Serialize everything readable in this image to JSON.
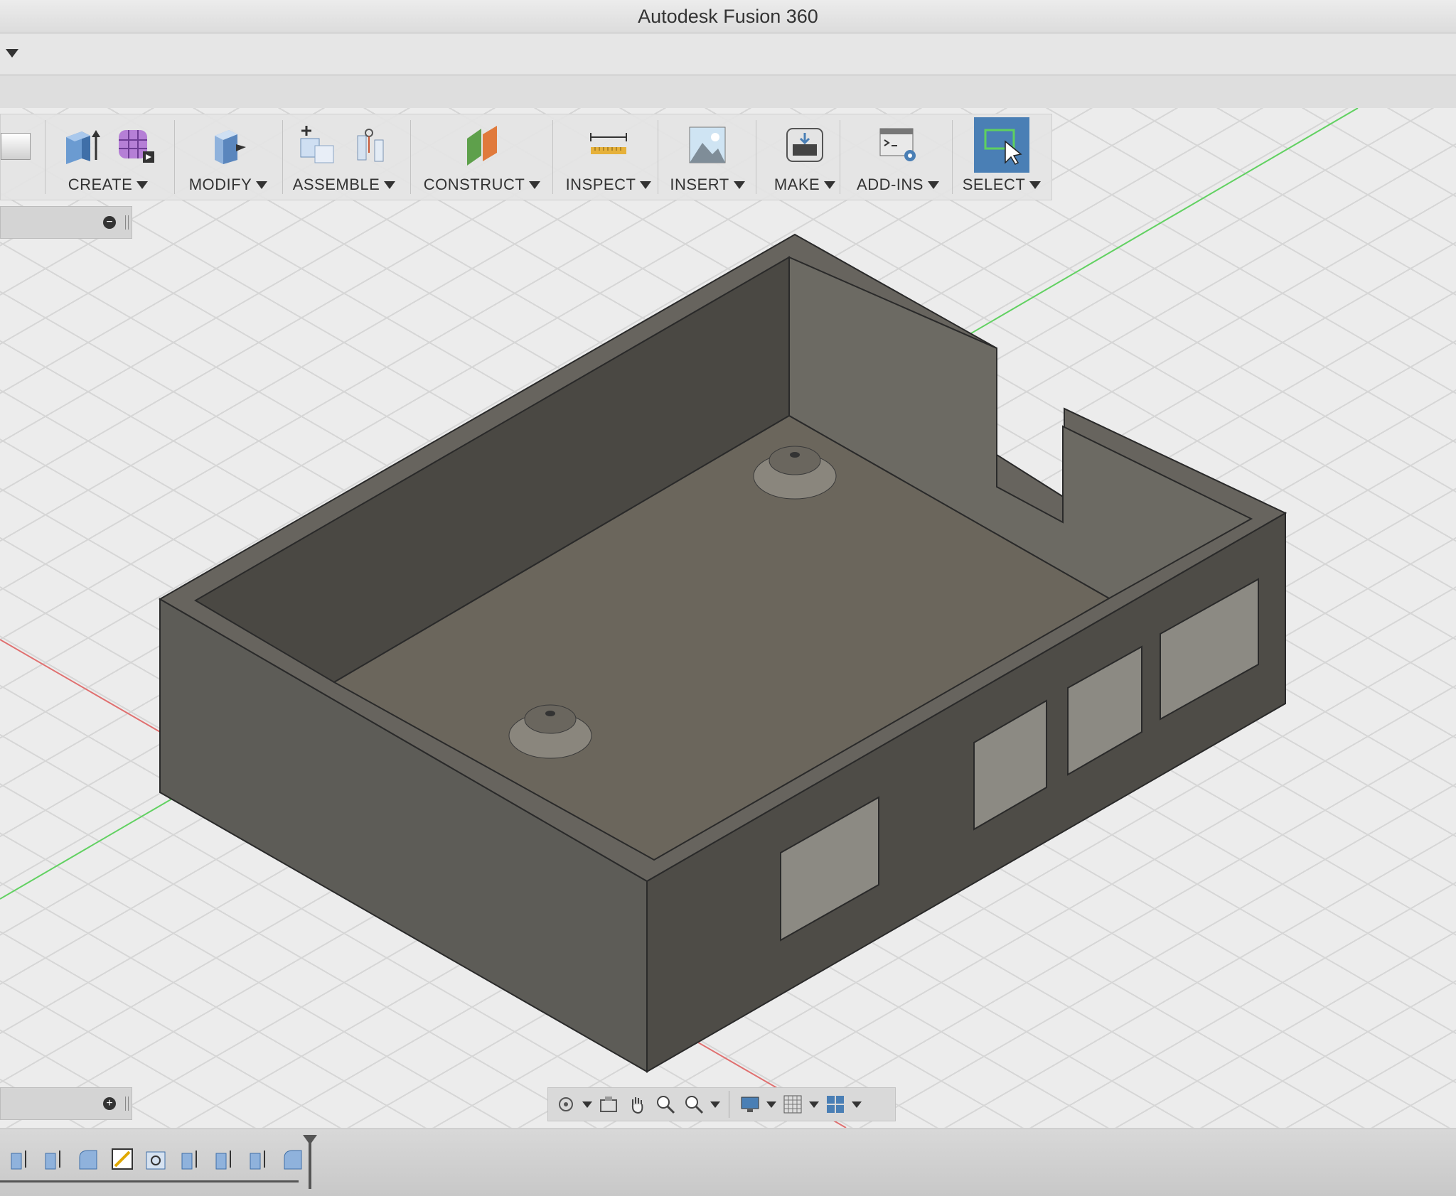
{
  "app": {
    "title": "Autodesk Fusion 360"
  },
  "toolbar": {
    "tools": [
      {
        "id": "create",
        "label": "CREATE"
      },
      {
        "id": "modify",
        "label": "MODIFY"
      },
      {
        "id": "assemble",
        "label": "ASSEMBLE"
      },
      {
        "id": "construct",
        "label": "CONSTRUCT"
      },
      {
        "id": "inspect",
        "label": "INSPECT"
      },
      {
        "id": "insert",
        "label": "INSERT"
      },
      {
        "id": "make",
        "label": "MAKE"
      },
      {
        "id": "add_ins",
        "label": "ADD-INS"
      },
      {
        "id": "select",
        "label": "SELECT"
      }
    ]
  },
  "panels": {
    "browser_collapse": "−",
    "comments_expand": "+"
  },
  "icons": {
    "create": [
      "extrude-icon",
      "form-icon"
    ],
    "modify": [
      "press-pull-icon"
    ],
    "assemble": [
      "new-component-icon",
      "joint-icon"
    ],
    "construct": [
      "plane-icon"
    ],
    "inspect": [
      "measure-icon"
    ],
    "insert": [
      "insert-image-icon"
    ],
    "make": [
      "3d-print-icon"
    ],
    "add_ins": [
      "scripts-icon"
    ],
    "select": [
      "window-select-icon"
    ]
  },
  "colors": {
    "select_active": "#4a7fb5",
    "model_body": "#5f5d57",
    "grid_line": "#d6d6d6"
  }
}
